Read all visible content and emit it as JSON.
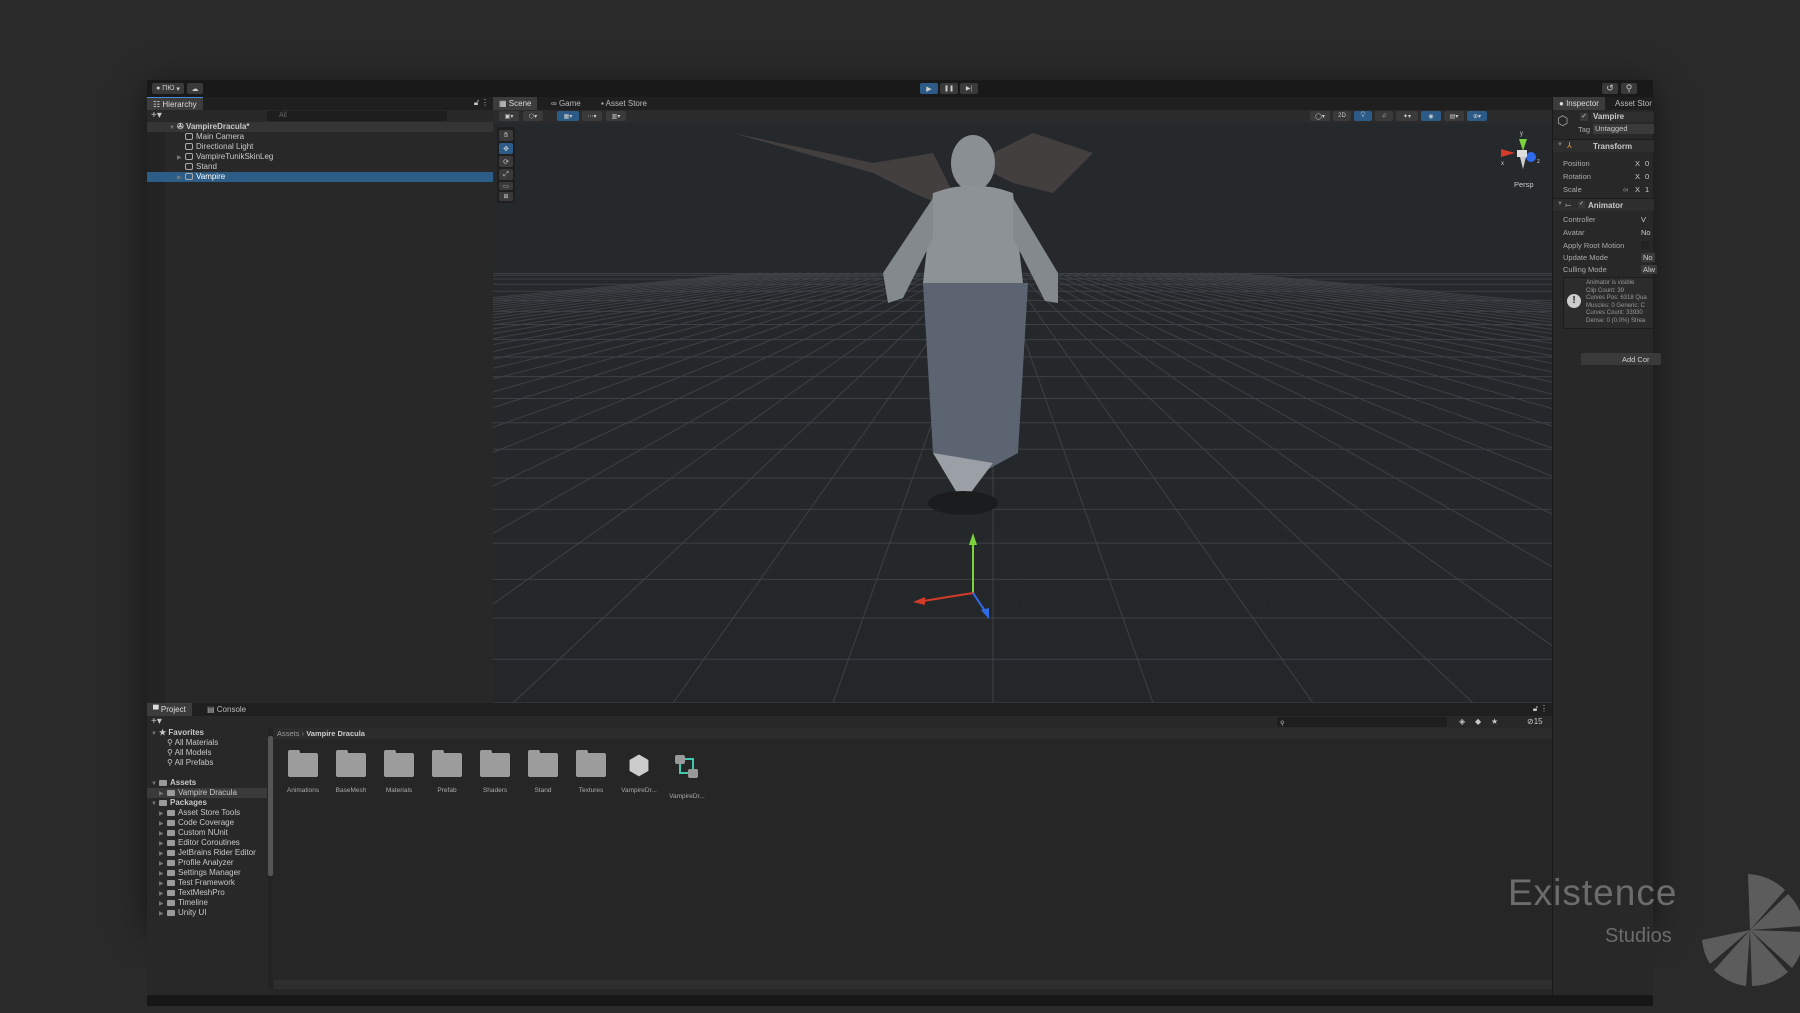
{
  "toolbar": {
    "account": "ПЮ",
    "play": "▶",
    "pause": "❚❚",
    "step": "▶|"
  },
  "hierarchy": {
    "tab": "Hierarchy",
    "search_placeholder": "All",
    "items": [
      {
        "label": "VampireDracula*",
        "depth": 0,
        "scene": true
      },
      {
        "label": "Main Camera",
        "depth": 1
      },
      {
        "label": "Directional Light",
        "depth": 1
      },
      {
        "label": "VampireTunikSkinLeg",
        "depth": 1,
        "expandable": true
      },
      {
        "label": "Stand",
        "depth": 1
      },
      {
        "label": "Vampire",
        "depth": 1,
        "expandable": true,
        "selected": true
      }
    ]
  },
  "scene": {
    "tabs": [
      "Scene",
      "Game",
      "Asset Store"
    ],
    "mode_2d": "2D",
    "projection": "Persp",
    "gizmo_axes": {
      "x": "x",
      "y": "y",
      "z": "z"
    }
  },
  "inspector": {
    "tabs": [
      "Inspector",
      "Asset Stor"
    ],
    "object_name": "Vampire",
    "tag_label": "Tag",
    "tag_value": "Untagged",
    "transform": {
      "title": "Transform",
      "fields": [
        {
          "label": "Position",
          "axis": "X",
          "value": "0"
        },
        {
          "label": "Rotation",
          "axis": "X",
          "value": "0"
        },
        {
          "label": "Scale",
          "axis": "X",
          "value": "1"
        }
      ]
    },
    "animator": {
      "title": "Animator",
      "fields": [
        {
          "label": "Controller",
          "value": "V"
        },
        {
          "label": "Avatar",
          "value": "No"
        },
        {
          "label": "Apply Root Motion",
          "value": ""
        },
        {
          "label": "Update Mode",
          "value": "No"
        },
        {
          "label": "Culling Mode",
          "value": "Alw"
        }
      ],
      "info": [
        "Animator is visible",
        "Clip Count: 39",
        "Curves Pos: 6318 Qua",
        "Muscles: 0 Generic: C",
        "Curves Count: 33930",
        "Dense: 0 (0.0%) Strea"
      ]
    },
    "add_component": "Add Cor"
  },
  "project": {
    "tabs": [
      "Project",
      "Console"
    ],
    "favorites": {
      "label": "Favorites",
      "items": [
        "All Materials",
        "All Models",
        "All Prefabs"
      ]
    },
    "assets": {
      "label": "Assets",
      "items": [
        "Vampire Dracula"
      ]
    },
    "packages": {
      "label": "Packages",
      "items": [
        "Asset Store Tools",
        "Code Coverage",
        "Custom NUnit",
        "Editor Coroutines",
        "JetBrains Rider Editor",
        "Profile Analyzer",
        "Settings Manager",
        "Test Framework",
        "TextMeshPro",
        "Timeline",
        "Unity UI"
      ]
    },
    "breadcrumb": [
      "Assets",
      "Vampire Dracula"
    ],
    "hidden_count": "15",
    "files": [
      {
        "name": "Animations",
        "type": "folder"
      },
      {
        "name": "BaseMesh",
        "type": "folder"
      },
      {
        "name": "Materials",
        "type": "folder"
      },
      {
        "name": "Prefab",
        "type": "folder"
      },
      {
        "name": "Shaders",
        "type": "folder"
      },
      {
        "name": "Stand",
        "type": "folder"
      },
      {
        "name": "Textures",
        "type": "folder"
      },
      {
        "name": "VampireDr...",
        "type": "unity-scene"
      },
      {
        "name": "VampireDr...",
        "type": "animator-controller"
      }
    ]
  },
  "watermark": {
    "line1": "Existence",
    "line2": "Studios"
  }
}
